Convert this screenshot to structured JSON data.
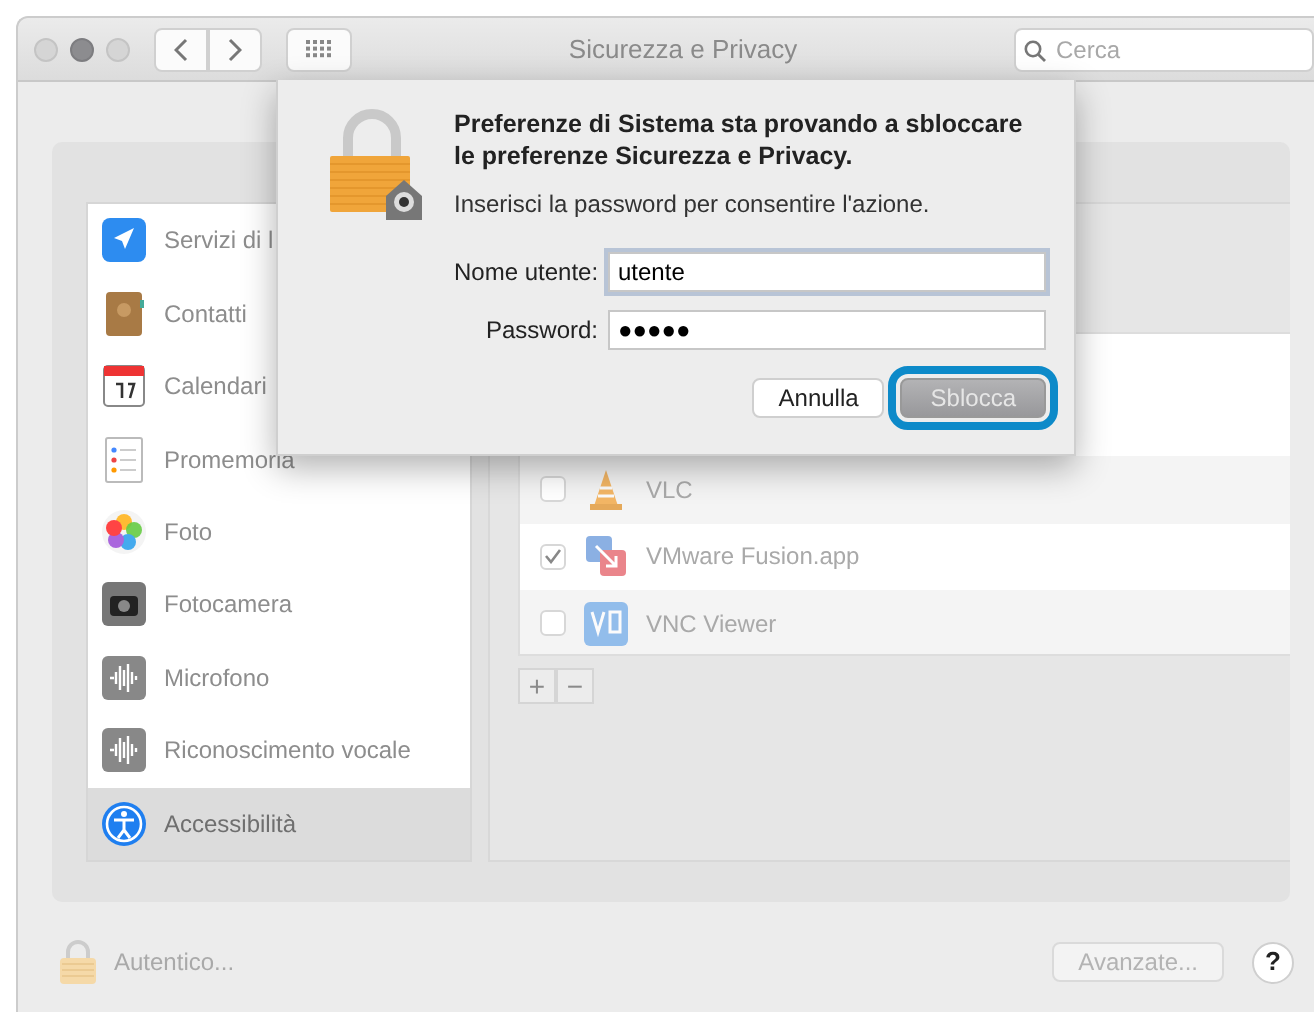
{
  "window": {
    "title": "Sicurezza e Privacy",
    "search": {
      "placeholder": "Cerca"
    }
  },
  "sidebar": {
    "items": [
      {
        "label": "Servizi di l",
        "selected": false
      },
      {
        "label": "Contatti",
        "selected": false
      },
      {
        "label": "Calendari",
        "selected": false
      },
      {
        "label": "Promemoria",
        "selected": false
      },
      {
        "label": "Foto",
        "selected": false
      },
      {
        "label": "Fotocamera",
        "selected": false
      },
      {
        "label": "Microfono",
        "selected": false
      },
      {
        "label": "Riconoscimento vocale",
        "selected": false
      },
      {
        "label": "Accessibilità",
        "selected": true
      }
    ]
  },
  "apps": [
    {
      "name": "VLC",
      "checked": false
    },
    {
      "name": "VMware Fusion.app",
      "checked": true
    },
    {
      "name": "VNC Viewer",
      "checked": false
    }
  ],
  "list_buttons": [
    "+",
    "−"
  ],
  "dialog": {
    "title": "Preferenze di Sistema sta provando a sbloccare le preferenze Sicurezza e Privacy.",
    "message": "Inserisci la password per consentire l'azione.",
    "fields": [
      {
        "label": "Nome utente:",
        "value": "utente"
      },
      {
        "label": "Password:",
        "value": "●●●●●"
      }
    ],
    "buttons": [
      {
        "label": "Annulla",
        "focused": false
      },
      {
        "label": "Sblocca",
        "focused": true
      }
    ]
  },
  "footer": {
    "lock_label": "Autentico...",
    "advanced": {
      "label": "Avanzate...",
      "disabled": true
    },
    "help": "?"
  }
}
